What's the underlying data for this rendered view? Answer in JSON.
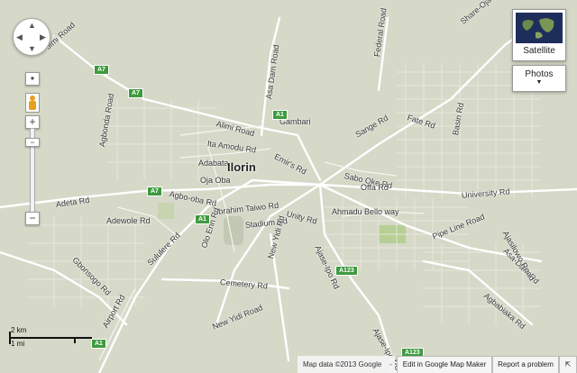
{
  "map": {
    "background": "#d6d8c8",
    "road_color": "#ffffff",
    "major_road_color": "#f4f4ee",
    "park_color": "#b7cf94",
    "city_label": "Ilorin",
    "road_labels": [
      "Jimi Road",
      "Asa Dam Road",
      "Alimi Road",
      "Ita Amodu Rd",
      "Gambari",
      "Emir's Rd",
      "Adabata",
      "Oja Oba",
      "Agbo-oba Rd",
      "Agbonda Road",
      "Adeta Rd",
      "Adewole Rd",
      "Gbonsogo Rd",
      "Ibrahim Taiwo Rd",
      "Stadium Rd",
      "Unity Rd",
      "Sabo Oke Rd",
      "Offa Rd",
      "Ahmadu Bello way",
      "Ajase-Ipo Rd",
      "Sange Rd",
      "Fate Rd",
      "Basin Rd",
      "Federal Road",
      "Share-Oja Rd",
      "University Rd",
      "Pipe Line Road",
      "Agbabiaka Rd",
      "Asa-Dam Rd",
      "Sululere Rd",
      "Olo Erin Rd",
      "New Yidi Rd",
      "Cemetery Rd",
      "New Yidi Road",
      "Airport Rd",
      "Ajase-Ipo Rd",
      "Ajasilowo Road"
    ],
    "shields": [
      "A7",
      "A7",
      "A1",
      "A7",
      "A1",
      "A123",
      "A1",
      "A123"
    ]
  },
  "controls": {
    "satellite_label": "Satellite",
    "photos_label": "Photos",
    "zoom_in": "+",
    "zoom_out": "−",
    "zoom_plus_small": "+"
  },
  "scale": {
    "km": "2 km",
    "mi": "1 mi"
  },
  "footer": {
    "attribution": "Map data ©2013 Google",
    "separator": "-",
    "edit_label": "Edit in Google Map Maker",
    "report_label": "Report a problem"
  }
}
